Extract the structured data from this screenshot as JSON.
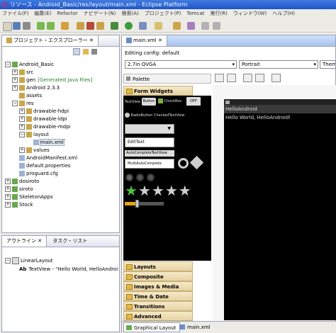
{
  "window": {
    "title": "リソース - Android_Basic/res/layout/main.xml - Eclipse Platform"
  },
  "menu": [
    "ファイル(F)",
    "編集(E)",
    "Refactor",
    "ナビゲート(N)",
    "検索(A)",
    "プロジェクト(P)",
    "Tomcat",
    "実行(R)",
    "ウィンドウ(W)",
    "ヘルプ(H)"
  ],
  "explorer": {
    "tab": "プロジェクト・エクスプローラー",
    "items": [
      {
        "label": "Android_Basic",
        "indent": 0,
        "tw": "−"
      },
      {
        "label": "src",
        "indent": 1,
        "tw": "+"
      },
      {
        "label": "gen",
        "suffix": "[Generated Java Files]",
        "indent": 1,
        "tw": "+"
      },
      {
        "label": "Android 2.3.3",
        "indent": 1,
        "tw": "+"
      },
      {
        "label": "assets",
        "indent": 1,
        "tw": ""
      },
      {
        "label": "res",
        "indent": 1,
        "tw": "−"
      },
      {
        "label": "drawable-hdpi",
        "indent": 2,
        "tw": "+"
      },
      {
        "label": "drawable-ldpi",
        "indent": 2,
        "tw": "+"
      },
      {
        "label": "drawable-mdpi",
        "indent": 2,
        "tw": "+"
      },
      {
        "label": "layout",
        "indent": 2,
        "tw": "−"
      },
      {
        "label": "main.xml",
        "indent": 3,
        "tw": ""
      },
      {
        "label": "values",
        "indent": 2,
        "tw": "+"
      },
      {
        "label": "AndroidManifest.xml",
        "indent": 1,
        "tw": ""
      },
      {
        "label": "default.properties",
        "indent": 1,
        "tw": ""
      },
      {
        "label": "proguard.cfg",
        "indent": 1,
        "tw": ""
      },
      {
        "label": "dosiroto",
        "indent": 0,
        "tw": "+"
      },
      {
        "label": "siroto",
        "indent": 0,
        "tw": "+"
      },
      {
        "label": "SkeletonApps",
        "indent": 0,
        "tw": "+"
      },
      {
        "label": "Stock",
        "indent": 0,
        "tw": "+"
      }
    ]
  },
  "outline": {
    "tab1": "アウトライン",
    "tab2": "タスク・リスト",
    "root": "LinearLayout",
    "child": "TextView - \"Hello World, HelloAndroi"
  },
  "editor": {
    "tab": "main.xml",
    "config_label": "Editing config: default",
    "device": "2.7in QVGA",
    "orientation": "Portrait",
    "theme": "Theme",
    "palette": "Palette",
    "form_widgets": "Form Widgets",
    "widgets": {
      "textview": "TextView",
      "button": "Button",
      "checkbox": "CheckBox",
      "toggle": "OFF",
      "radio": "RadioButton",
      "checkedtext": "CheckedTextView",
      "edittext": "EditText",
      "autocomplete": "AutoCompleteTextView",
      "multiauto": "MultiAutoComplete"
    },
    "rating": 1,
    "progress": 0.3,
    "categories": [
      "Layouts",
      "Composite",
      "Images & Media",
      "Time & Date",
      "Transitions",
      "Advanced"
    ],
    "preview": {
      "app_title": "HelloAndroid",
      "text": "Hello World, HelloAndroid!"
    },
    "bottom_tabs": [
      "Graphical Layout",
      "main.xml"
    ]
  }
}
